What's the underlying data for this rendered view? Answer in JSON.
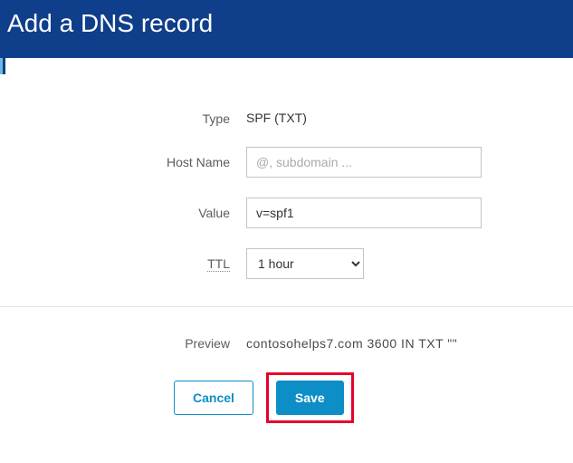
{
  "header": {
    "title": "Add a DNS record"
  },
  "form": {
    "type": {
      "label": "Type",
      "value": "SPF (TXT)"
    },
    "hostName": {
      "label": "Host Name",
      "placeholder": "@, subdomain ...",
      "value": ""
    },
    "value": {
      "label": "Value",
      "value": "v=spf1"
    },
    "ttl": {
      "label": "TTL",
      "selected": "1 hour"
    }
  },
  "preview": {
    "label": "Preview",
    "text": "contosohelps7.com  3600  IN  TXT  \"\""
  },
  "buttons": {
    "cancel": "Cancel",
    "save": "Save"
  }
}
